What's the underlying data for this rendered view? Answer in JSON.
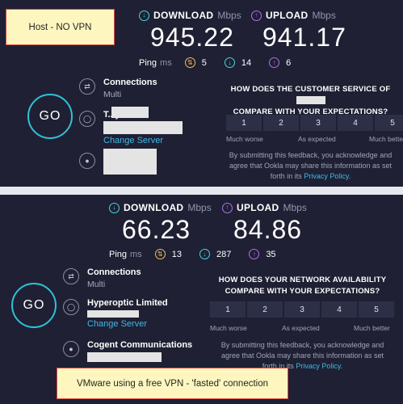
{
  "top": {
    "note": "Host - NO VPN",
    "download": {
      "label": "DOWNLOAD",
      "unit": "Mbps",
      "value": "945.22"
    },
    "upload": {
      "label": "UPLOAD",
      "unit": "Mbps",
      "value": "941.17"
    },
    "ping": {
      "label": "Ping",
      "unit": "ms",
      "idle": "5",
      "download": "14",
      "upload": "6"
    },
    "go": "GO",
    "connections": {
      "title": "Connections",
      "value": "Multi"
    },
    "isp": {
      "title": "T...y.",
      "link": "Change Server"
    },
    "survey": {
      "question_line1": "HOW DOES THE CUSTOMER SERVICE OF",
      "question_line2": "COMPARE WITH YOUR EXPECTATIONS?",
      "ratings": [
        "1",
        "2",
        "3",
        "4",
        "5"
      ],
      "scale_low": "Much worse",
      "scale_mid": "As expected",
      "scale_high": "Much better",
      "disclaimer_1": "By submitting this feedback, you acknowledge and",
      "disclaimer_2": "agree that Ookla may share this information as set",
      "disclaimer_3": "forth in its",
      "privacy_link": "Privacy Policy",
      "period": "."
    }
  },
  "bottom": {
    "note": "VMware using a free VPN - 'fasted' connection",
    "download": {
      "label": "DOWNLOAD",
      "unit": "Mbps",
      "value": "66.23"
    },
    "upload": {
      "label": "UPLOAD",
      "unit": "Mbps",
      "value": "84.86"
    },
    "ping": {
      "label": "Ping",
      "unit": "ms",
      "idle": "13",
      "download": "287",
      "upload": "35"
    },
    "go": "GO",
    "connections": {
      "title": "Connections",
      "value": "Multi"
    },
    "isp": {
      "title": "Hyperoptic Limited",
      "link": "Change Server"
    },
    "server": {
      "title": "Cogent Communications"
    },
    "survey": {
      "question_line1": "HOW DOES YOUR NETWORK AVAILABILITY",
      "question_line2": "COMPARE WITH YOUR EXPECTATIONS?",
      "ratings": [
        "1",
        "2",
        "3",
        "4",
        "5"
      ],
      "scale_low": "Much worse",
      "scale_mid": "As expected",
      "scale_high": "Much better",
      "disclaimer_1": "By submitting this feedback, you acknowledge and",
      "disclaimer_2": "agree that Ookla may share this information as set",
      "disclaimer_3": "forth in its",
      "privacy_link": "Privacy Policy",
      "period": "."
    }
  },
  "icons": {
    "download": "download-arrow-icon",
    "upload": "upload-arrow-icon",
    "ping_idle": "ping-idle-icon",
    "connections": "connections-icon",
    "globe": "globe-icon",
    "user": "user-icon"
  },
  "colors": {
    "background": "#1f2033",
    "download_accent": "#43d6e0",
    "upload_accent": "#b36ef0",
    "ping_accent": "#f0c05a",
    "link": "#3fb9e8",
    "note_bg": "#fdf7bf",
    "note_border": "#e04747"
  }
}
